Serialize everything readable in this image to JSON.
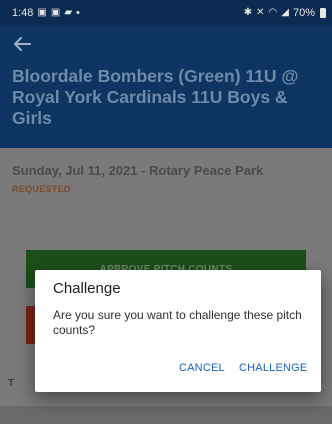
{
  "status_bar": {
    "time": "1:48",
    "left_icons": [
      "gallery-icon",
      "gallery-icon",
      "chat-icon"
    ],
    "dot": "•",
    "right_icons": [
      "bluetooth-icon",
      "mute-icon",
      "wifi-icon",
      "signal-icon"
    ],
    "battery": "70%"
  },
  "app_bar": {
    "back_icon": "arrow-left-icon",
    "title": "Bloordale Bombers (Green) 11U @ Royal York Cardinals 11U Boys & Girls"
  },
  "game": {
    "date_location": "Sunday, Jul 11, 2021 - Rotary Peace Park",
    "status": "REQUESTED"
  },
  "actions": {
    "approve_label": "APPROVE PITCH COUNTS"
  },
  "section": {
    "label_fragment": "T"
  },
  "dialog": {
    "title": "Challenge",
    "message": "Are you sure you want to challenge these pitch counts?",
    "cancel_label": "CANCEL",
    "confirm_label": "CHALLENGE"
  },
  "colors": {
    "header": "#0e3461",
    "accent": "#1565c0",
    "approve": "#2e7d32",
    "challenge": "#c62828",
    "status": "#e57a3c"
  }
}
